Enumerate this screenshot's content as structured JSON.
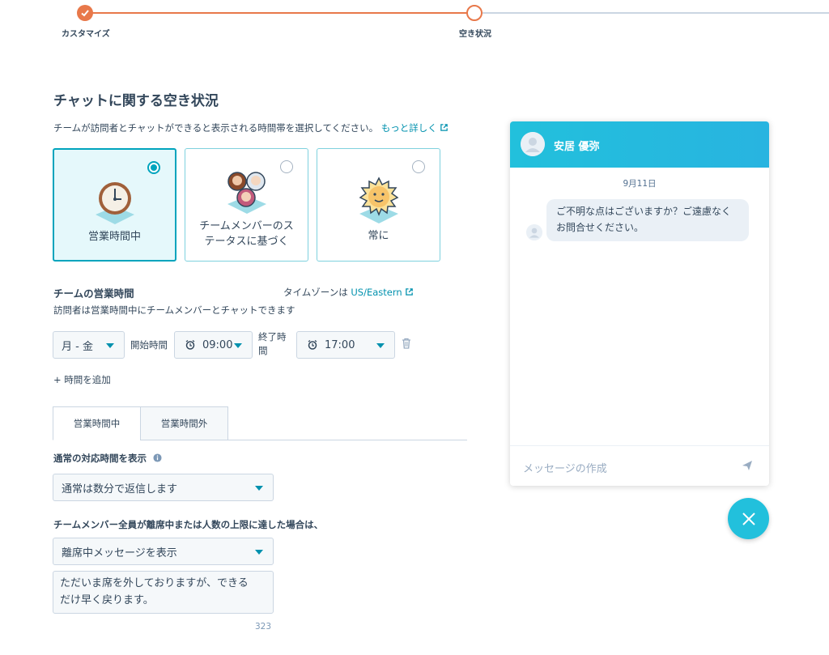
{
  "stepper": {
    "steps": [
      {
        "label": "カスタマイズ",
        "state": "done"
      },
      {
        "label": "空き状況",
        "state": "current"
      }
    ]
  },
  "page": {
    "title": "チャットに関する空き状況",
    "subtitle": "チームが訪問者とチャットができると表示される時間帯を選択してください。",
    "learn_more": "もっと詳しく"
  },
  "options": [
    {
      "label": "営業時間中",
      "selected": true,
      "icon": "clock-icon"
    },
    {
      "label_line1": "チームメンバーのス",
      "label_line2": "テータスに基づく",
      "selected": false,
      "icon": "team-avatars-icon"
    },
    {
      "label": "常に",
      "selected": false,
      "icon": "sun-icon"
    }
  ],
  "business_hours": {
    "title": "チームの営業時間",
    "timezone_prefix": "タイムゾーンは",
    "timezone": "US/Eastern",
    "description": "訪問者は営業時間中にチームメンバーとチャットできます",
    "days": "月 - 金",
    "start_label": "開始時間",
    "start_time": "09:00",
    "end_label_line1": "終了時",
    "end_label_line2": "間",
    "end_time": "17:00",
    "add_hours": "+ 時間を追加"
  },
  "tabs": [
    {
      "label": "営業時間中",
      "active": true
    },
    {
      "label": "営業時間外",
      "active": false
    }
  ],
  "response_time": {
    "label": "通常の対応時間を表示",
    "value": "通常は数分で返信します"
  },
  "away": {
    "label": "チームメンバー全員が離席中または人数の上限に達した場合は、",
    "value": "離席中メッセージを表示",
    "message_line1": "ただいま席を外しておりますが、できる",
    "message_line2": "だけ早く戻ります。",
    "counter": "323"
  },
  "chat_preview": {
    "name": "安居 優弥",
    "date": "9月11日",
    "message_line1": "ご不明な点はございますか？ご遠慮なく",
    "message_line2": "お問合せください。",
    "input_placeholder": "メッセージの作成"
  },
  "colors": {
    "accent": "#00a4bd",
    "step_done": "#e8784a",
    "chat_header": "#22c0dc",
    "link": "#0091ae"
  }
}
